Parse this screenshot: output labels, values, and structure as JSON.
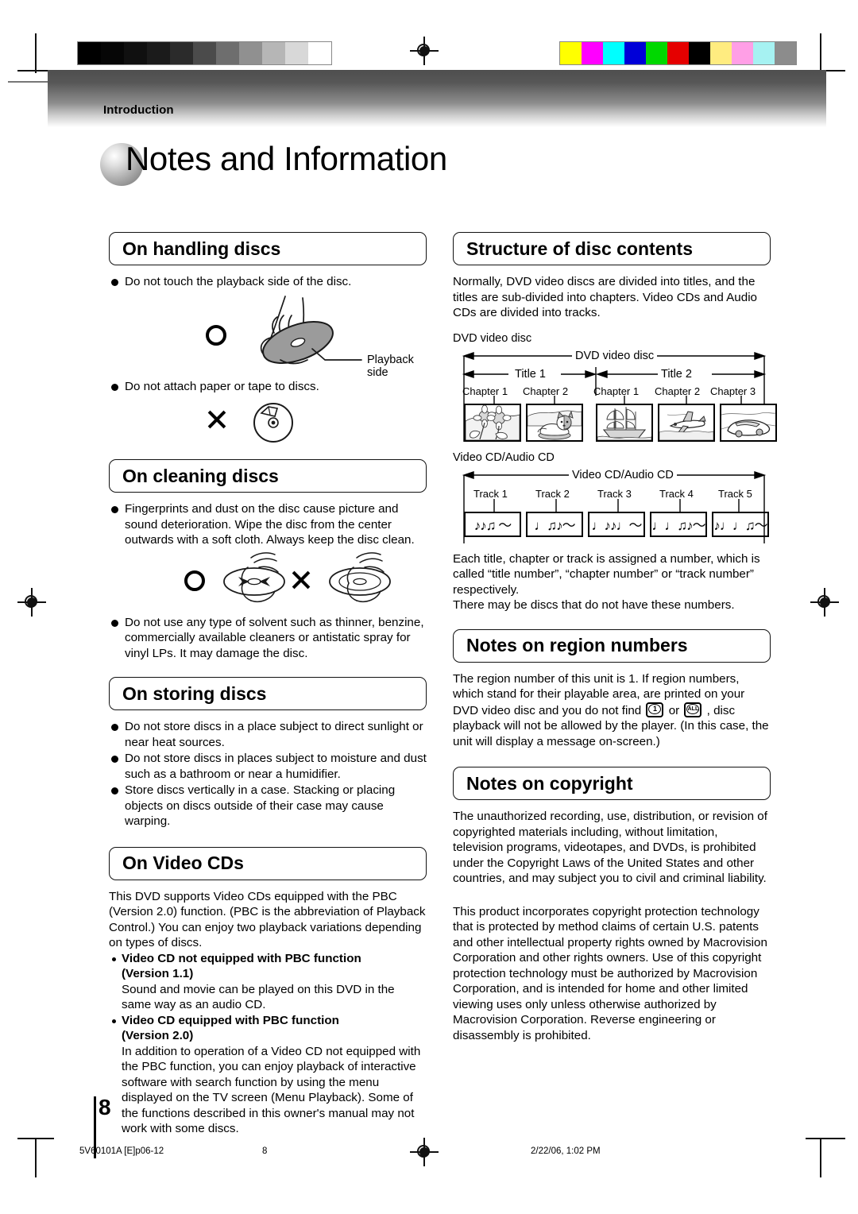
{
  "header": {
    "section_label": "Introduction",
    "page_title": "Notes and Information"
  },
  "left_column": {
    "handling": {
      "heading": "On handling discs",
      "bullets": [
        "Do not touch the playback side of the disc.",
        "Do not attach paper or tape to discs."
      ],
      "figure_caption": "Playback side",
      "ok_mark": "circle-ok-mark",
      "ng_mark": "cross-ng-mark"
    },
    "cleaning": {
      "heading": "On cleaning discs",
      "bullets": [
        "Fingerprints and dust on the disc cause picture and sound deterioration. Wipe the disc from the center outwards with a soft cloth. Always keep the disc clean.",
        "Do not use any type of solvent such as thinner, benzine, commercially available cleaners or antistatic spray for vinyl LPs. It may damage the disc."
      ]
    },
    "storing": {
      "heading": "On storing discs",
      "bullets": [
        "Do not store discs in a place subject to direct sunlight or near heat sources.",
        "Do not store discs in places subject to moisture and dust such as a bathroom or near a humidifier.",
        "Store discs vertically in a case. Stacking or placing objects on discs outside of their case may cause warping."
      ]
    },
    "video_cds": {
      "heading": "On Video CDs",
      "intro": "This DVD supports Video CDs equipped with the PBC (Version 2.0) function. (PBC is the abbreviation of Playback Control.) You can enjoy two playback variations depending on types of discs.",
      "items": [
        {
          "title": "Video CD not equipped with PBC function",
          "version": "(Version 1.1)",
          "body": "Sound and movie can be played on this DVD in the same way as an audio CD."
        },
        {
          "title": "Video CD equipped with PBC function",
          "version": "(Version 2.0)",
          "body": "In addition to operation of a Video CD not equipped with the PBC function, you can enjoy playback of interactive software with search function by using the menu displayed on the TV screen (Menu Playback). Some of the functions described in this owner's manual may not work with some discs."
        }
      ]
    }
  },
  "right_column": {
    "structure": {
      "heading": "Structure of disc contents",
      "intro": "Normally, DVD video discs are divided into titles, and the titles are sub-divided into chapters. Video CDs and Audio CDs are divided into tracks.",
      "dvd_diagram": {
        "outer_label": "DVD video disc",
        "span_label": "DVD video disc",
        "titles": [
          {
            "label": "Title 1",
            "chapters": [
              "Chapter 1",
              "Chapter 2"
            ]
          },
          {
            "label": "Title 2",
            "chapters": [
              "Chapter 1",
              "Chapter 2",
              "Chapter 3"
            ]
          }
        ],
        "thumbnails": [
          "sunflower-illustration",
          "cat-illustration",
          "sailing-ship-illustration",
          "airplane-illustration",
          "car-illustration"
        ]
      },
      "cd_diagram": {
        "outer_label": "Video CD/Audio CD",
        "span_label": "Video CD/Audio CD",
        "tracks": [
          "Track 1",
          "Track 2",
          "Track 3",
          "Track 4",
          "Track 5"
        ],
        "track_glyphs": [
          "♪♪♫ 〜",
          "♩♫♪〜",
          "♩♪♪♩〜",
          "♩♩♫♪〜",
          "♪♩♩♫〜"
        ]
      },
      "closing": "Each title, chapter or track is assigned a number, which is called “title number”, “chapter number” or “track number” respectively.\nThere may be discs that do not have these numbers."
    },
    "region": {
      "heading": "Notes on region numbers",
      "text_part1": "The region number of this unit is 1. If region numbers, which stand for their playable area, are printed on your DVD video disc and you do not find ",
      "icon1_label": "1",
      "text_between": " or ",
      "icon2_label": "ALL",
      "text_part2": " , disc playback will not be allowed by the player. (In this case, the unit will display a message on-screen.)"
    },
    "copyright": {
      "heading": "Notes on copyright",
      "paragraph1": "The unauthorized recording, use, distribution, or revision of copyrighted materials including, without limitation, television programs, videotapes, and DVDs, is prohibited under the Copyright Laws of the United States and other countries, and may subject you to civil and criminal liability.",
      "paragraph2": "This product incorporates copyright protection technology that is protected by method claims of certain U.S. patents and other intellectual property rights owned by Macrovision Corporation and other rights owners. Use of this copyright protection technology must be authorized by Macrovision Corporation, and is intended for home and other limited viewing uses only unless otherwise authorized by Macrovision Corporation. Reverse engineering or disassembly is prohibited."
    }
  },
  "page_number": "8",
  "footer": {
    "file_id": "5V60101A [E]p06-12",
    "page": "8",
    "timestamp": "2/22/06, 1:02 PM"
  },
  "print_marks": {
    "grayscale_steps": [
      "#000000",
      "#060606",
      "#101010",
      "#1b1b1b",
      "#2b2b2b",
      "#4b4b4b",
      "#6e6e6e",
      "#909090",
      "#b6b6b6",
      "#d8d8d8",
      "#ffffff"
    ],
    "color_steps": [
      "#ffff00",
      "#ff00ff",
      "#00ffff",
      "#0000d8",
      "#00d800",
      "#e50000",
      "#000000",
      "#ffec80",
      "#ff9fe6",
      "#a6f2f2",
      "#8c8c8c"
    ]
  }
}
